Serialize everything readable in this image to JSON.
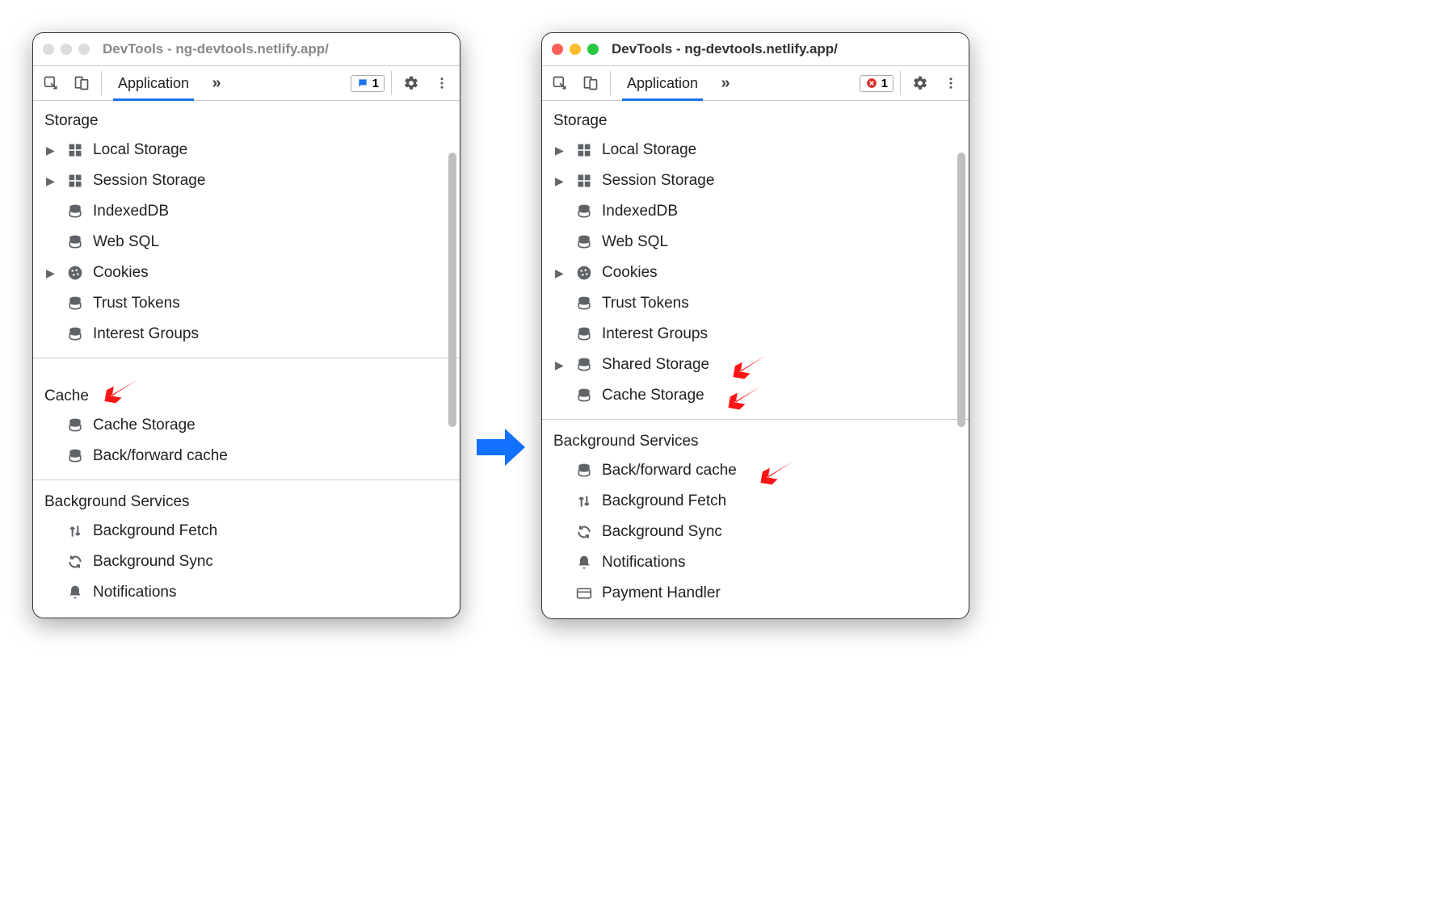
{
  "arrow_color": "#1271ff",
  "annotation_arrow_color": "#ff1414",
  "left": {
    "title": "DevTools - ng-devtools.netlify.app/",
    "active": false,
    "tab": "Application",
    "badge": {
      "style": "blue",
      "count": "1"
    },
    "sections": [
      {
        "head": "Storage",
        "arrow_after": false,
        "items": [
          {
            "expandable": true,
            "icon": "grid",
            "label": "Local Storage"
          },
          {
            "expandable": true,
            "icon": "grid",
            "label": "Session Storage"
          },
          {
            "expandable": false,
            "icon": "db",
            "label": "IndexedDB"
          },
          {
            "expandable": false,
            "icon": "db",
            "label": "Web SQL"
          },
          {
            "expandable": true,
            "icon": "cookie",
            "label": "Cookies"
          },
          {
            "expandable": false,
            "icon": "db",
            "label": "Trust Tokens"
          },
          {
            "expandable": false,
            "icon": "db",
            "label": "Interest Groups"
          }
        ]
      },
      {
        "head": "Cache",
        "arrow_after": true,
        "items": [
          {
            "expandable": false,
            "icon": "db",
            "label": "Cache Storage"
          },
          {
            "expandable": false,
            "icon": "db",
            "label": "Back/forward cache"
          }
        ]
      },
      {
        "head": "Background Services",
        "arrow_after": false,
        "items": [
          {
            "expandable": false,
            "icon": "updown",
            "label": "Background Fetch"
          },
          {
            "expandable": false,
            "icon": "sync",
            "label": "Background Sync"
          },
          {
            "expandable": false,
            "icon": "bell",
            "label": "Notifications"
          }
        ]
      }
    ]
  },
  "right": {
    "title": "DevTools - ng-devtools.netlify.app/",
    "active": true,
    "tab": "Application",
    "badge": {
      "style": "red",
      "count": "1"
    },
    "sections": [
      {
        "head": "Storage",
        "arrow_after": false,
        "items": [
          {
            "expandable": true,
            "icon": "grid",
            "label": "Local Storage"
          },
          {
            "expandable": true,
            "icon": "grid",
            "label": "Session Storage"
          },
          {
            "expandable": false,
            "icon": "db",
            "label": "IndexedDB"
          },
          {
            "expandable": false,
            "icon": "db",
            "label": "Web SQL"
          },
          {
            "expandable": true,
            "icon": "cookie",
            "label": "Cookies"
          },
          {
            "expandable": false,
            "icon": "db",
            "label": "Trust Tokens"
          },
          {
            "expandable": false,
            "icon": "db",
            "label": "Interest Groups"
          },
          {
            "expandable": true,
            "icon": "db",
            "label": "Shared Storage",
            "arrow_after": true
          },
          {
            "expandable": false,
            "icon": "db",
            "label": "Cache Storage",
            "arrow_after": true
          }
        ]
      },
      {
        "head": "Background Services",
        "arrow_after": false,
        "items": [
          {
            "expandable": false,
            "icon": "db",
            "label": "Back/forward cache",
            "arrow_after": true
          },
          {
            "expandable": false,
            "icon": "updown",
            "label": "Background Fetch"
          },
          {
            "expandable": false,
            "icon": "sync",
            "label": "Background Sync"
          },
          {
            "expandable": false,
            "icon": "bell",
            "label": "Notifications"
          },
          {
            "expandable": false,
            "icon": "card",
            "label": "Payment Handler"
          }
        ]
      }
    ]
  }
}
